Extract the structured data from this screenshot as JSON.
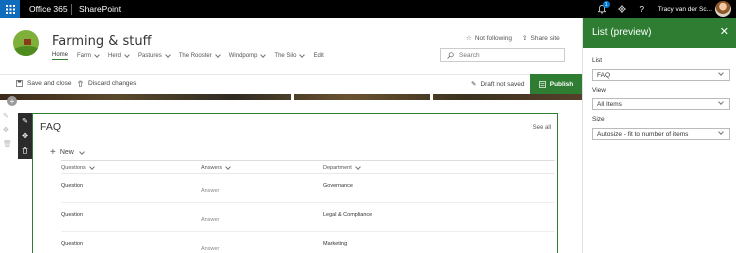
{
  "suite_bar": {
    "app_name": "Office 365",
    "site_app": "SharePoint",
    "notification_count": "1",
    "help_label": "?",
    "user_name": "Tracy van der Sc..."
  },
  "site": {
    "title": "Farming & stuff",
    "nav": [
      {
        "label": "Home"
      },
      {
        "label": "Farm"
      },
      {
        "label": "Herd"
      },
      {
        "label": "Pastures"
      },
      {
        "label": "The Rooster"
      },
      {
        "label": "Windpomp"
      },
      {
        "label": "The Silo"
      },
      {
        "label": "Edit"
      }
    ],
    "following_label": "Not following",
    "share_label": "Share site",
    "search_placeholder": "Search"
  },
  "command_bar": {
    "save_close": "Save and close",
    "discard": "Discard changes",
    "draft_status": "Draft not saved",
    "publish": "Publish"
  },
  "webpart": {
    "title": "FAQ",
    "see_all": "See all",
    "new_label": "New",
    "columns": [
      "Questions",
      "Answers",
      "Department"
    ],
    "rows": [
      {
        "question": "Question",
        "answer": "Answer",
        "department": "Governance"
      },
      {
        "question": "Question",
        "answer": "Answer",
        "department": "Legal & Compliance"
      },
      {
        "question": "Question",
        "answer": "Answer",
        "department": "Marketing"
      }
    ]
  },
  "panel": {
    "title": "List (preview)",
    "list_label": "List",
    "list_value": "FAQ",
    "view_label": "View",
    "view_value": "All Items",
    "size_label": "Size",
    "size_value": "Autosize - fit to number of items"
  },
  "colors": {
    "accent_green": "#2e7d32",
    "suite_bar": "#000000",
    "waffle_blue": "#0f6cbd"
  },
  "icons": [
    "waffle-icon",
    "bell-icon",
    "gear-icon",
    "help-icon",
    "star-icon",
    "share-icon",
    "search-icon",
    "save-icon",
    "discard-icon",
    "pencil-icon",
    "publish-icon",
    "move-icon",
    "delete-icon",
    "add-section-icon",
    "close-icon",
    "chevron-down-icon",
    "plus-icon"
  ]
}
